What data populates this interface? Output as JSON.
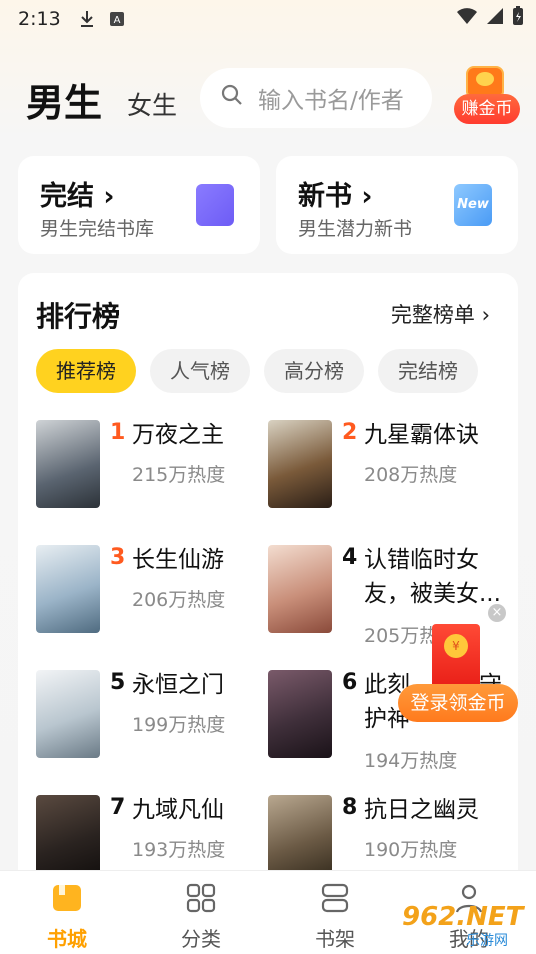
{
  "status": {
    "time": "2:13"
  },
  "header": {
    "tab_male": "男生",
    "tab_female": "女生",
    "search_placeholder": "输入书名/作者",
    "earn_label": "赚金币"
  },
  "cards": [
    {
      "title": "完结 ›",
      "subtitle": "男生完结书库",
      "icon": "purple-book-icon"
    },
    {
      "title": "新书 ›",
      "subtitle": "男生潜力新书",
      "icon": "new-badge-icon",
      "badge": "New"
    }
  ],
  "ranking": {
    "title": "排行榜",
    "full_link": "完整榜单 ›",
    "tabs": [
      "推荐榜",
      "人气榜",
      "高分榜",
      "完结榜"
    ],
    "active_tab": 0,
    "books": [
      {
        "rank": "1",
        "title": "万夜之主",
        "heat": "215万热度",
        "cover_color": "#5a6470"
      },
      {
        "rank": "2",
        "title": "九星霸体诀",
        "heat": "208万热度",
        "cover_color": "#7a5a3a"
      },
      {
        "rank": "3",
        "title": "长生仙游",
        "heat": "206万热度",
        "cover_color": "#9bb4c8"
      },
      {
        "rank": "4",
        "title": "认错临时女友，被美女...",
        "heat": "205万热度",
        "cover_color": "#c98f7a"
      },
      {
        "rank": "5",
        "title": "永恒之门",
        "heat": "199万热度",
        "cover_color": "#b9c6cf"
      },
      {
        "rank": "6",
        "title": "此刻，华夏守护神",
        "heat": "194万热度",
        "cover_color": "#3f2f3a"
      },
      {
        "rank": "7",
        "title": "九域凡仙",
        "heat": "193万热度",
        "cover_color": "#2a2320"
      },
      {
        "rank": "8",
        "title": "抗日之幽灵",
        "heat": "190万热度",
        "cover_color": "#6b5a45"
      }
    ]
  },
  "floater": {
    "button": "登录领金币",
    "coin_symbol": "¥"
  },
  "bottom_nav": [
    {
      "label": "书城",
      "icon": "bookstore-icon",
      "active": true
    },
    {
      "label": "分类",
      "icon": "category-grid-icon",
      "active": false
    },
    {
      "label": "书架",
      "icon": "bookshelf-icon",
      "active": false
    },
    {
      "label": "我的",
      "icon": "profile-icon",
      "active": false
    }
  ],
  "watermark": {
    "main": "962.NET",
    "sub": "乐游网"
  }
}
